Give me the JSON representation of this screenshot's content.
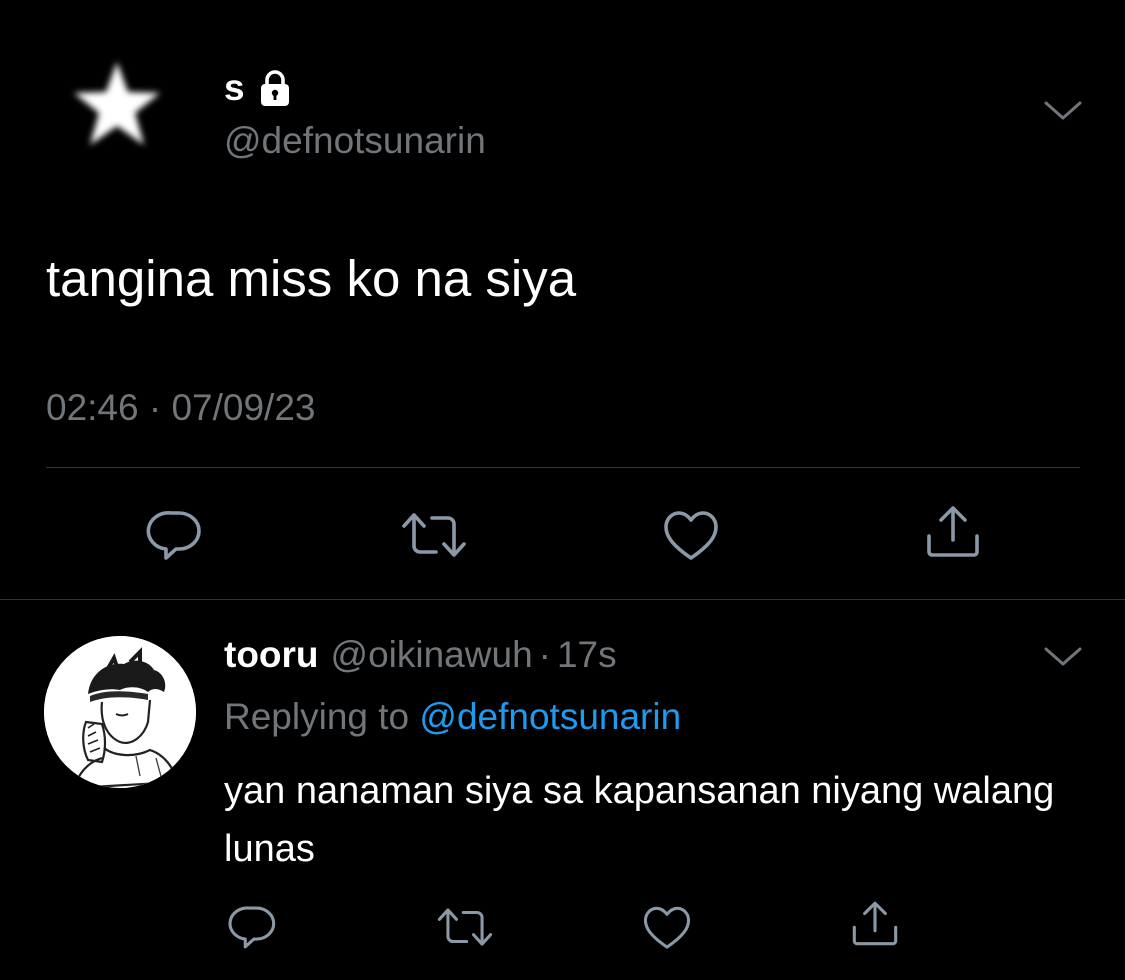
{
  "colors": {
    "background": "#000000",
    "primary_text": "#ffffff",
    "secondary_text": "#71767b",
    "link": "#1d9bf0",
    "divider": "#2f3336",
    "icon": "#8b98a5"
  },
  "main_tweet": {
    "avatar_icon": "star-icon",
    "display_name": "s",
    "protected_icon": "lock-icon",
    "handle": "@defnotsunarin",
    "menu_icon": "chevron-down-icon",
    "text": "tangina miss ko na siya",
    "timestamp": "02:46 · 07/09/23",
    "actions": [
      {
        "name": "reply",
        "icon": "comment-icon"
      },
      {
        "name": "retweet",
        "icon": "retweet-icon"
      },
      {
        "name": "like",
        "icon": "heart-icon"
      },
      {
        "name": "share",
        "icon": "share-icon"
      }
    ]
  },
  "reply_tweet": {
    "avatar_icon": "anime-avatar",
    "display_name": "tooru",
    "handle": "@oikinawuh",
    "separator": "·",
    "time": "17s",
    "menu_icon": "chevron-down-icon",
    "replying_prefix": "Replying to",
    "replying_to": "@defnotsunarin",
    "text": "yan nanaman siya sa kapansanan niyang walang lunas",
    "actions": [
      {
        "name": "reply",
        "icon": "comment-icon"
      },
      {
        "name": "retweet",
        "icon": "retweet-icon"
      },
      {
        "name": "like",
        "icon": "heart-icon"
      },
      {
        "name": "share",
        "icon": "share-icon"
      }
    ]
  }
}
